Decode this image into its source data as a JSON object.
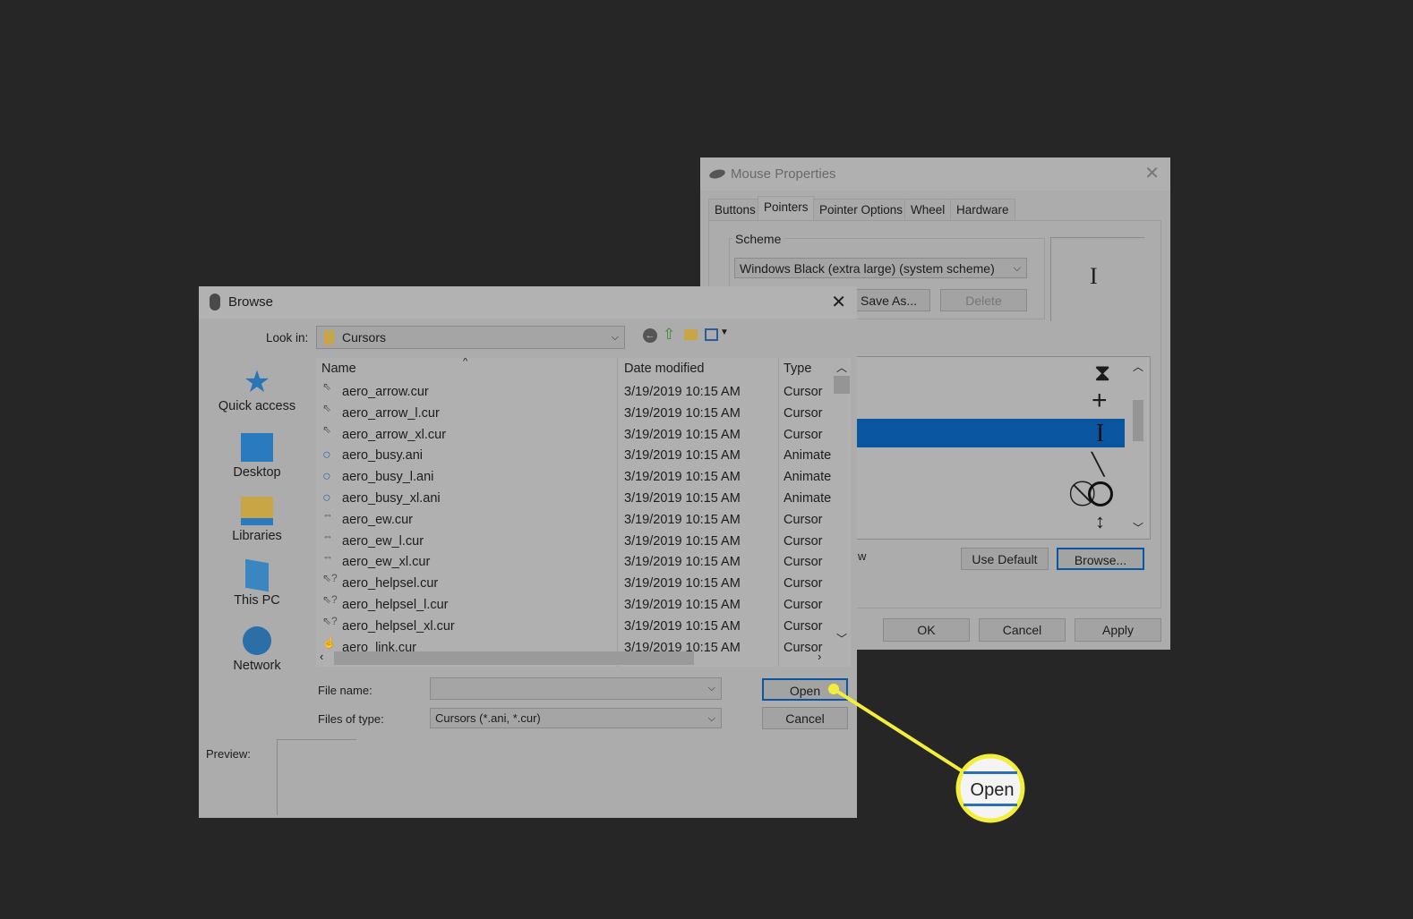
{
  "mouse_properties": {
    "title": "Mouse Properties",
    "tabs": [
      "Buttons",
      "Pointers",
      "Pointer Options",
      "Wheel",
      "Hardware"
    ],
    "active_tab": "Pointers",
    "scheme_label": "Scheme",
    "scheme_value": "Windows Black (extra large) (system scheme)",
    "save_as": "Save As...",
    "delete": "Delete",
    "partial_label": "w",
    "use_default": "Use Default",
    "browse": "Browse...",
    "ok": "OK",
    "cancel": "Cancel",
    "apply": "Apply",
    "selected_color": "#0a56a0"
  },
  "browse": {
    "title": "Browse",
    "look_in_label": "Look in:",
    "look_in_value": "Cursors",
    "places": [
      "Quick access",
      "Desktop",
      "Libraries",
      "This PC",
      "Network"
    ],
    "columns": [
      "Name",
      "Date modified",
      "Type"
    ],
    "files": [
      {
        "name": "aero_arrow.cur",
        "date": "3/19/2019 10:15 AM",
        "type": "Cursor",
        "icon": "arrow-icon"
      },
      {
        "name": "aero_arrow_l.cur",
        "date": "3/19/2019 10:15 AM",
        "type": "Cursor",
        "icon": "arrow-icon"
      },
      {
        "name": "aero_arrow_xl.cur",
        "date": "3/19/2019 10:15 AM",
        "type": "Cursor",
        "icon": "arrow-icon"
      },
      {
        "name": "aero_busy.ani",
        "date": "3/19/2019 10:15 AM",
        "type": "Animate",
        "icon": "busy-icon"
      },
      {
        "name": "aero_busy_l.ani",
        "date": "3/19/2019 10:15 AM",
        "type": "Animate",
        "icon": "busy-icon"
      },
      {
        "name": "aero_busy_xl.ani",
        "date": "3/19/2019 10:15 AM",
        "type": "Animate",
        "icon": "busy-icon"
      },
      {
        "name": "aero_ew.cur",
        "date": "3/19/2019 10:15 AM",
        "type": "Cursor",
        "icon": "resize-ew-icon"
      },
      {
        "name": "aero_ew_l.cur",
        "date": "3/19/2019 10:15 AM",
        "type": "Cursor",
        "icon": "resize-ew-icon"
      },
      {
        "name": "aero_ew_xl.cur",
        "date": "3/19/2019 10:15 AM",
        "type": "Cursor",
        "icon": "resize-ew-icon"
      },
      {
        "name": "aero_helpsel.cur",
        "date": "3/19/2019 10:15 AM",
        "type": "Cursor",
        "icon": "help-select-icon"
      },
      {
        "name": "aero_helpsel_l.cur",
        "date": "3/19/2019 10:15 AM",
        "type": "Cursor",
        "icon": "help-select-icon"
      },
      {
        "name": "aero_helpsel_xl.cur",
        "date": "3/19/2019 10:15 AM",
        "type": "Cursor",
        "icon": "help-select-icon"
      },
      {
        "name": "aero_link.cur",
        "date": "3/19/2019 10:15 AM",
        "type": "Cursor",
        "icon": "link-hand-icon"
      }
    ],
    "file_name_label": "File name:",
    "file_name_value": "",
    "files_of_type_label": "Files of type:",
    "files_of_type_value": "Cursors (*.ani, *.cur)",
    "open": "Open",
    "cancel": "Cancel",
    "preview_label": "Preview:"
  },
  "callout": {
    "label": "Open",
    "color": "#f3ee3c"
  }
}
